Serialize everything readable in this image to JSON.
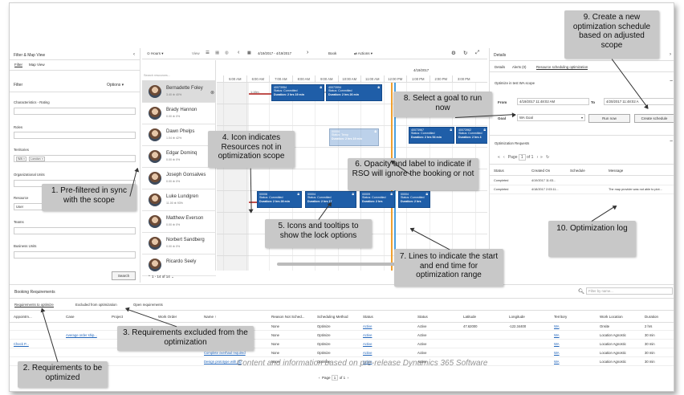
{
  "left": {
    "title": "Filter & Map View",
    "tabs": [
      "Filter",
      "Map View"
    ],
    "filter_label": "Filter",
    "options_label": "Options",
    "sections": [
      "Characteristics - Rating",
      "Roles",
      "Territories",
      "Organizational Units",
      "Resource",
      "Teams",
      "Business Units"
    ],
    "territory_chips": [
      "WA ×",
      "London ×"
    ],
    "resource_value": "User",
    "search_button": "Search"
  },
  "toolbar": {
    "hours": "Hours",
    "view": "View",
    "date_range": "4/19/2017 - 4/19/2017",
    "book": "Book",
    "actions": "Actions"
  },
  "resources": {
    "search_placeholder": "Search resources...",
    "items": [
      {
        "name": "Bernadette Foley",
        "sub": "3.40 ⊕    40%"
      },
      {
        "name": "Brady Hannon",
        "sub": "0.00 ⊕    0%"
      },
      {
        "name": "Dawn Phelps",
        "sub": "1.04 ⊕    42%"
      },
      {
        "name": "Edgar Dominq",
        "sub": "0.00 ⊕    0%"
      },
      {
        "name": "Joseph Gonsalves",
        "sub": "0.00 ⊕    0%"
      },
      {
        "name": "Luke Lundgren",
        "sub": "11.00 ⊕    93%"
      },
      {
        "name": "Matthew Everson",
        "sub": "0.00 ⊕    0%"
      },
      {
        "name": "Norbert Sandberg",
        "sub": "0.00 ⊕    0%"
      },
      {
        "name": "Ricardo Seely",
        "sub": ""
      }
    ],
    "pager": "1 - 14 of 14"
  },
  "schedule": {
    "date": "4/19/2017",
    "hours": [
      "5:00 AM",
      "6:00 AM",
      "7:00 AM",
      "8:00 AM",
      "9:00 AM",
      "10:00 AM",
      "11:00 AM",
      "12:00 PM",
      "1:00 PM",
      "2:00 PM",
      "3:00 PM"
    ],
    "travel_labels": [
      "1:19m",
      "25m",
      "28m"
    ],
    "bookings": [
      {
        "id": "40073954",
        "status": "Status: Committed",
        "duration": "Duration: 2 hrs 19 min"
      },
      {
        "id": "40073994",
        "status": "Status: Committed",
        "duration": "Duration: 2 hrs 26 min"
      },
      {
        "id": "00006",
        "status": "Status: Temp",
        "duration": "Duration: 2 hrs 19 min"
      },
      {
        "id": "40073967",
        "status": "Status: Committed",
        "duration": "Duration: 2 hrs 54 min"
      },
      {
        "id": "40073962",
        "status": "Status: Committed",
        "duration": "Duration: 2 hrs 4"
      },
      {
        "id": "00006",
        "status": "Status: Committed",
        "duration": "Duration: 2 hrs 28 min"
      },
      {
        "id": "00004",
        "status": "Status: Committed",
        "duration": "Duration: 2 hrs 17"
      },
      {
        "id": "00009",
        "status": "Status: Committed",
        "duration": "Duration: 2 hrs"
      },
      {
        "id": "00004",
        "status": "Status: Committed",
        "duration": "Duration: 2 hrs"
      }
    ]
  },
  "details": {
    "title": "Details",
    "tabs": [
      "Details",
      "Alerts (0)",
      "Resource scheduling optimization"
    ],
    "scope_label": "Optimize in test WA scope",
    "from_label": "From",
    "from_value": "4/19/2017 11:48:02 AM",
    "to_label": "To",
    "to_value": "4/20/2017 11:48:02 A",
    "goal_label": "Goal",
    "goal_value": "WA Goal",
    "run_now": "Run now",
    "create_schedule": "Create schedule",
    "requests_title": "Optimization Requests",
    "page_label": "Page",
    "page_num": "1",
    "page_of": "of 1",
    "columns": [
      "Status",
      "Created On",
      "Schedule",
      "Message"
    ],
    "rows": [
      {
        "status": "Completed",
        "created": "4/19/2017 11:03...",
        "schedule": "",
        "message": ""
      },
      {
        "status": "Completed",
        "created": "4/18/2017 2:03:11...",
        "schedule": "",
        "message": "The map provider was not able to plot..."
      }
    ]
  },
  "bottom": {
    "title": "Booking Requirements",
    "search_placeholder": "Filter by name...",
    "tabs": [
      "Requirements to optimize",
      "Excluded from optimization",
      "Open requirements"
    ],
    "columns": [
      "Appointm...",
      "Case",
      "Project",
      "Work Order",
      "Name ↑",
      "Reason Not Sched...",
      "Scheduling Method",
      "Status",
      "Status",
      "Latitude",
      "Longitude",
      "Territory",
      "Work Location",
      "Duration"
    ],
    "rows": [
      {
        "a": "",
        "case": "",
        "wo": "",
        "name": "",
        "reason": "None",
        "method": "Optimize",
        "s1": "Active",
        "s2": "Active",
        "lat": "47.62000",
        "lon": "-122.34400",
        "terr": "WA",
        "loc": "Onsite",
        "dur": "2 hrs"
      },
      {
        "a": "",
        "case": "Average order ship...",
        "wo": "",
        "name": "",
        "reason": "None",
        "method": "Optimize",
        "s1": "Active",
        "s2": "Active",
        "lat": "",
        "lon": "",
        "terr": "WA",
        "loc": "Location Agnostic",
        "dur": "30 min"
      },
      {
        "a": "Check P...",
        "case": "",
        "wo": "",
        "name": "",
        "reason": "None",
        "method": "Optimize",
        "s1": "Active",
        "s2": "Active",
        "lat": "",
        "lon": "",
        "terr": "WA",
        "loc": "Location Agnostic",
        "dur": "30 min"
      },
      {
        "a": "",
        "case": "",
        "wo": "",
        "name": "Complete overhaul required",
        "reason": "None",
        "method": "Optimize",
        "s1": "Active",
        "s2": "Active",
        "lat": "",
        "lon": "",
        "terr": "WA",
        "loc": "Location Agnostic",
        "dur": "30 min"
      },
      {
        "a": "",
        "case": "",
        "wo": "",
        "name": "Design prototype with 3D",
        "reason": "None",
        "method": "Optimize",
        "s1": "Active",
        "s2": "Active",
        "lat": "",
        "lon": "",
        "terr": "WA",
        "loc": "Location Agnostic",
        "dur": "30 min"
      }
    ],
    "page_label": "Page",
    "page_num": "1",
    "page_of": "of 1"
  },
  "watermark": "Content and information based on pre-release Dynamics 365 Software",
  "callouts": {
    "c1": "1. Pre-filtered in sync with the scope",
    "c2": "2. Requirements to be optimized",
    "c3": "3. Requirements excluded from the optimization",
    "c4": "4. Icon indicates Resources not in optimization scope",
    "c5": "5. Icons and tooltips to show the lock options",
    "c6": "6. Opacity and label to indicate if RSO will ignore the booking or not",
    "c7": "7. Lines to indicate the start and end time for optimization range",
    "c8": "8. Select a goal to run now",
    "c9": "9. Create a new optimization schedule based on adjusted scope",
    "c10": "10. Optimization log"
  },
  "colors": {
    "booking": "#1f5ea8",
    "callout": "#c8c8c8",
    "line_orange": "#f0a030",
    "line_blue": "#4aa0e0",
    "travel": "#c0504d"
  }
}
